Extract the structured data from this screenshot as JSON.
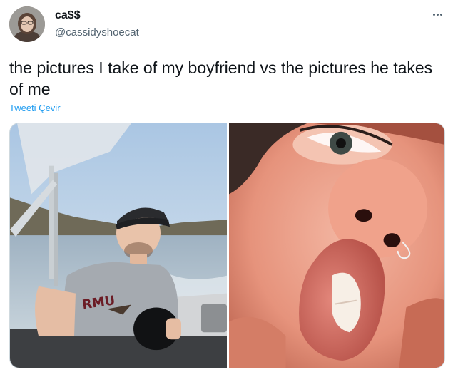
{
  "user": {
    "display_name": "ca$$",
    "handle": "@cassidyshoecat",
    "avatar_icon": "profile-avatar"
  },
  "tweet": {
    "text": "the pictures I take of my boyfriend vs the pictures he takes of me",
    "translate_label": "Tweeti Çevir"
  },
  "media": {
    "left_photo": "boyfriend-on-boat-photo",
    "right_photo": "close-up-face-photo",
    "shirt_text": "RMU"
  },
  "colors": {
    "text": "#0f1419",
    "secondary": "#536471",
    "link": "#1d9bf0",
    "border": "#cfd9de"
  }
}
